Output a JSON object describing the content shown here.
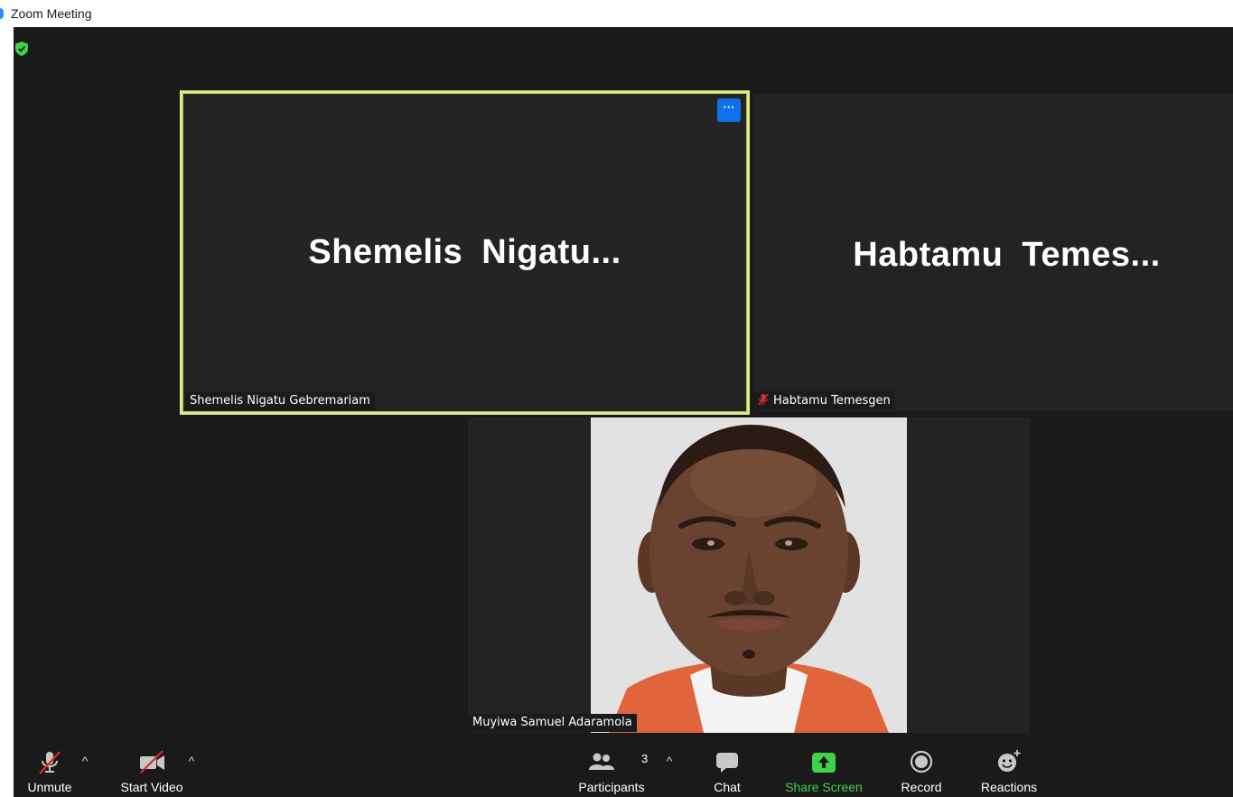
{
  "window": {
    "title": "Zoom Meeting"
  },
  "colors": {
    "active_speaker_border": "#e6e88a",
    "more_button": "#0e71eb",
    "share_screen": "#3fd24b",
    "muted_icon": "#e02828",
    "security_shield": "#3fd24b"
  },
  "participants": [
    {
      "display_name": "Shemelis  Nigatu...",
      "label": "Shemelis Nigatu Gebremariam",
      "active_speaker": true,
      "muted": false,
      "video": false
    },
    {
      "display_name": "Habtamu  Temes...",
      "label": "Habtamu Temesgen",
      "active_speaker": false,
      "muted": true,
      "video": false
    },
    {
      "display_name": "",
      "label": "Muyiwa Samuel Adaramola",
      "active_speaker": false,
      "muted": false,
      "video": true
    }
  ],
  "tile_menu": {
    "more_label": "···"
  },
  "toolbar": {
    "unmute": "Unmute",
    "start_video": "Start Video",
    "participants": "Participants",
    "participants_count": "3",
    "chat": "Chat",
    "share_screen": "Share Screen",
    "record": "Record",
    "reactions": "Reactions",
    "caret": "^"
  },
  "icons": {
    "app": "zoom-app-icon",
    "security": "shield-check-icon",
    "mic": "microphone-muted-icon",
    "video": "video-off-icon",
    "participants": "people-icon",
    "chat": "chat-bubble-icon",
    "share": "share-screen-arrow-icon",
    "record": "record-circle-icon",
    "reactions": "smiley-plus-icon"
  }
}
